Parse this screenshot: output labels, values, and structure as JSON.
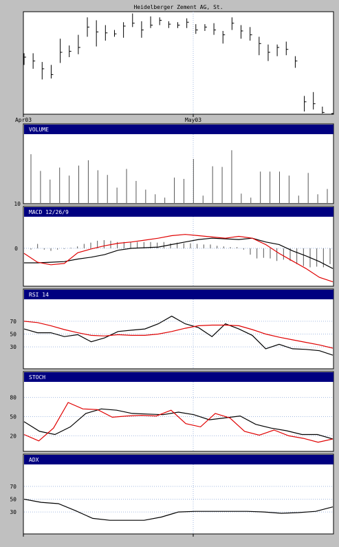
{
  "chart_data": {
    "type": "bar",
    "title": "Heidelberger Zement AG, St.",
    "x_tick_labels": [
      "Apr03",
      "May03"
    ],
    "colors": {
      "background": "#c0c0c0",
      "panel": "#ffffff",
      "header_bar": "#000080",
      "grid": "#a0b8e0",
      "primary_line": "#000000",
      "signal_line": "#e00000"
    },
    "price": {
      "type": "ohlc",
      "ylim": [
        0,
        100
      ],
      "bars": [
        {
          "h": 60,
          "l": 48,
          "c": 56
        },
        {
          "h": 60,
          "l": 44,
          "c": 52
        },
        {
          "h": 51,
          "l": 33,
          "c": 44
        },
        {
          "h": 48,
          "l": 34,
          "c": 38
        },
        {
          "h": 75,
          "l": 50,
          "c": 61
        },
        {
          "h": 68,
          "l": 56,
          "c": 62
        },
        {
          "h": 79,
          "l": 59,
          "c": 66
        },
        {
          "h": 97,
          "l": 77,
          "c": 87
        },
        {
          "h": 94,
          "l": 67,
          "c": 82
        },
        {
          "h": 89,
          "l": 73,
          "c": 81
        },
        {
          "h": 84,
          "l": 77,
          "c": 80
        },
        {
          "h": 92,
          "l": 76,
          "c": 88
        },
        {
          "h": 101,
          "l": 87,
          "c": 91
        },
        {
          "h": 93,
          "l": 76,
          "c": 84
        },
        {
          "h": 98,
          "l": 86,
          "c": 89
        },
        {
          "h": 97,
          "l": 89,
          "c": 94
        },
        {
          "h": 93,
          "l": 86,
          "c": 90
        },
        {
          "h": 92,
          "l": 86,
          "c": 89
        },
        {
          "h": 96,
          "l": 86,
          "c": 92
        },
        {
          "h": 90,
          "l": 80,
          "c": 84
        },
        {
          "h": 90,
          "l": 83,
          "c": 87
        },
        {
          "h": 91,
          "l": 79,
          "c": 84
        },
        {
          "h": 83,
          "l": 70,
          "c": 79
        },
        {
          "h": 97,
          "l": 84,
          "c": 91
        },
        {
          "h": 89,
          "l": 75,
          "c": 83
        },
        {
          "h": 87,
          "l": 73,
          "c": 79
        },
        {
          "h": 77,
          "l": 58,
          "c": 70
        },
        {
          "h": 69,
          "l": 52,
          "c": 61
        },
        {
          "h": 69,
          "l": 57,
          "c": 66
        },
        {
          "h": 72,
          "l": 58,
          "c": 64
        },
        {
          "h": 57,
          "l": 45,
          "c": 52
        },
        {
          "h": 16,
          "l": 0,
          "c": 10
        },
        {
          "h": 20,
          "l": 2,
          "c": 8
        },
        {
          "h": 5,
          "l": -8,
          "c": -1
        },
        {
          "h": -2,
          "l": -17,
          "c": -7
        }
      ]
    },
    "volume": {
      "label": "VOLUME",
      "ytick": "10",
      "ylim": [
        0,
        100
      ],
      "values": [
        72,
        47,
        34,
        52,
        40,
        55,
        63,
        48,
        41,
        22,
        50,
        32,
        19,
        12,
        7,
        37,
        35,
        65,
        10,
        54,
        53,
        78,
        13,
        7,
        46,
        46,
        46,
        40,
        10,
        44,
        12,
        20
      ]
    },
    "macd": {
      "label": "MACD 12/26/9",
      "ytick": "0",
      "ylim": [
        -60,
        50
      ],
      "macd_line": [
        -23,
        -23,
        -22,
        -21,
        -17,
        -14,
        -10,
        -3,
        0,
        1,
        2,
        6,
        10,
        14,
        16,
        15,
        14,
        16,
        10,
        6,
        -4,
        -12,
        -21,
        -32
      ],
      "signal_line": [
        -8,
        -22,
        -26,
        -24,
        -7,
        -1,
        4,
        8,
        10,
        13,
        16,
        20,
        22,
        20,
        18,
        16,
        19,
        16,
        6,
        -8,
        -20,
        -32,
        -46,
        -53
      ],
      "histogram": [
        -2,
        7,
        -2,
        -4,
        -2,
        -1,
        1,
        3,
        7,
        9,
        12,
        13,
        12,
        10,
        10,
        10,
        10,
        10,
        10,
        9,
        10,
        8,
        9,
        8,
        8,
        7,
        6,
        6,
        4,
        3,
        2,
        2,
        -2,
        -10,
        -16,
        -15,
        -16,
        -20,
        -18,
        -20,
        -25,
        -28,
        -30,
        -29,
        -30,
        -25
      ]
    },
    "rsi": {
      "label": "RSI 14",
      "yticks": [
        "70",
        "50",
        "30"
      ],
      "ylim": [
        0,
        100
      ],
      "rsi_line": [
        58,
        52,
        52,
        46,
        49,
        38,
        44,
        54,
        56,
        58,
        66,
        78,
        66,
        60,
        46,
        66,
        58,
        48,
        27,
        34,
        27,
        26,
        24,
        17
      ],
      "signal_line": [
        70,
        68,
        63,
        57,
        52,
        48,
        47,
        49,
        48,
        48,
        50,
        54,
        59,
        63,
        64,
        64,
        63,
        57,
        50,
        45,
        41,
        37,
        33,
        28
      ]
    },
    "stoch": {
      "label": "STOCH",
      "yticks": [
        "80",
        "50",
        "20"
      ],
      "ylim": [
        0,
        100
      ],
      "k_line": [
        42,
        27,
        22,
        34,
        55,
        62,
        60,
        55,
        54,
        53,
        57,
        53,
        45,
        48,
        51,
        38,
        32,
        28,
        22,
        22,
        15
      ],
      "d_line": [
        22,
        12,
        32,
        72,
        62,
        61,
        49,
        51,
        52,
        51,
        60,
        39,
        34,
        55,
        48,
        27,
        21,
        29,
        20,
        16,
        10,
        15
      ]
    },
    "adx": {
      "label": "ADX",
      "yticks": [
        "70",
        "50",
        "30"
      ],
      "ylim": [
        0,
        100
      ],
      "adx_line": [
        50,
        45,
        43,
        32,
        20,
        17,
        17,
        17,
        22,
        30,
        31,
        31,
        31,
        31,
        30,
        28,
        29,
        31,
        38
      ]
    }
  }
}
